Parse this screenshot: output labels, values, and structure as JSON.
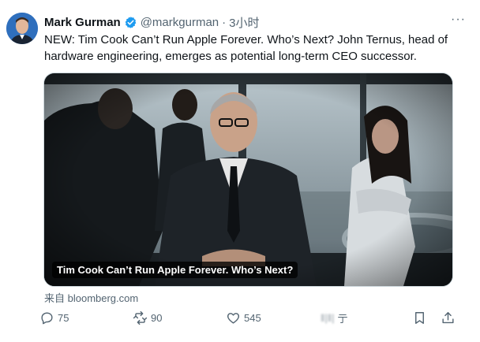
{
  "author": {
    "name": "Mark Gurman",
    "handle": "@markgurman",
    "separator": "·",
    "time": "3小时",
    "more": "···"
  },
  "tweet": {
    "text": "NEW: Tim Cook Can’t Run Apple Forever. Who’s Next? John Ternus, head of hardware engineering, emerges as potential long-term CEO successor."
  },
  "card": {
    "caption": "Tim Cook Can’t Run Apple Forever. Who’s Next?",
    "source": "来自 bloomberg.com"
  },
  "actions": {
    "replies": "75",
    "retweets": "90",
    "likes": "545",
    "views": "‖|‖|",
    "views_suffix": "亍"
  },
  "colors": {
    "accent": "#1d9bf0",
    "secondary_text": "#536471",
    "primary_text": "#0f1419"
  }
}
